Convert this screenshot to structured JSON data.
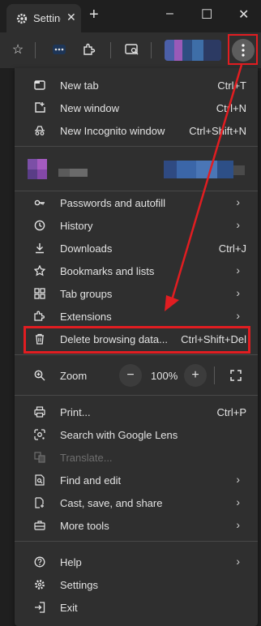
{
  "tab": {
    "title": "Settings",
    "close": "✕"
  },
  "titlebar": {
    "new_tab": "+",
    "minimize": "–",
    "maximize": "☐",
    "close": "✕"
  },
  "toolbar": {
    "icons": [
      "star-icon",
      "extensions-badge-icon",
      "puzzle-icon",
      "tab-search-icon",
      "profile-avatar",
      "menu-kebab-icon"
    ]
  },
  "menu": {
    "items": [
      {
        "label": "New tab",
        "shortcut": "Ctrl+T",
        "icon": "new-tab-icon"
      },
      {
        "label": "New window",
        "shortcut": "Ctrl+N",
        "icon": "new-window-icon"
      },
      {
        "label": "New Incognito window",
        "shortcut": "Ctrl+Shift+N",
        "icon": "incognito-icon"
      },
      {
        "label": "Passwords and autofill",
        "shortcut": "",
        "icon": "key-icon",
        "submenu": true
      },
      {
        "label": "History",
        "shortcut": "",
        "icon": "history-icon",
        "submenu": true
      },
      {
        "label": "Downloads",
        "shortcut": "Ctrl+J",
        "icon": "download-icon"
      },
      {
        "label": "Bookmarks and lists",
        "shortcut": "",
        "icon": "star-icon",
        "submenu": true
      },
      {
        "label": "Tab groups",
        "shortcut": "",
        "icon": "tab-groups-icon",
        "submenu": true
      },
      {
        "label": "Extensions",
        "shortcut": "",
        "icon": "puzzle-icon",
        "submenu": true
      },
      {
        "label": "Delete browsing data...",
        "shortcut": "Ctrl+Shift+Del",
        "icon": "trash-icon"
      },
      {
        "label": "Print...",
        "shortcut": "Ctrl+P",
        "icon": "print-icon"
      },
      {
        "label": "Search with Google Lens",
        "shortcut": "",
        "icon": "lens-icon"
      },
      {
        "label": "Translate...",
        "shortcut": "",
        "icon": "translate-icon",
        "disabled": true
      },
      {
        "label": "Find and edit",
        "shortcut": "",
        "icon": "find-icon",
        "submenu": true
      },
      {
        "label": "Cast, save, and share",
        "shortcut": "",
        "icon": "cast-icon",
        "submenu": true
      },
      {
        "label": "More tools",
        "shortcut": "",
        "icon": "toolbox-icon",
        "submenu": true
      },
      {
        "label": "Help",
        "shortcut": "",
        "icon": "help-icon",
        "submenu": true
      },
      {
        "label": "Settings",
        "shortcut": "",
        "icon": "gear-icon"
      },
      {
        "label": "Exit",
        "shortcut": "",
        "icon": "exit-icon"
      }
    ],
    "zoom": {
      "label": "Zoom",
      "value": "100%",
      "minus": "−",
      "plus": "+"
    }
  },
  "colors": {
    "highlight": "#e11d21",
    "menu_bg": "#2f2f2f",
    "frame_bg": "#1f1f1f"
  }
}
